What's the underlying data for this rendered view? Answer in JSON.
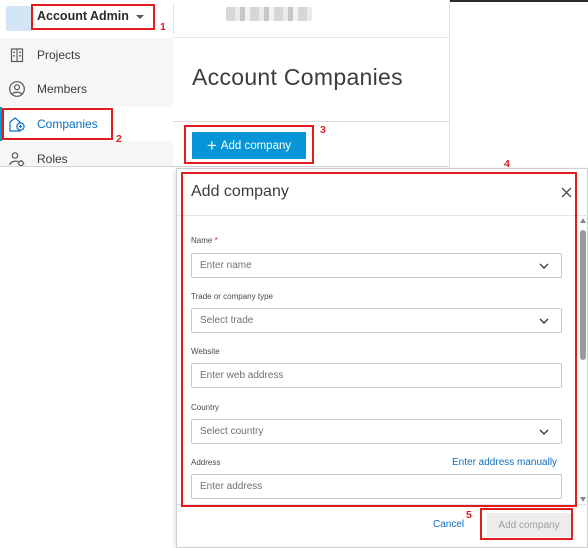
{
  "header": {
    "account_switcher_label": "Account Admin"
  },
  "sidebar": {
    "items": [
      {
        "label": "Projects",
        "icon": "building-icon",
        "active": false
      },
      {
        "label": "Members",
        "icon": "person-circle-icon",
        "active": false
      },
      {
        "label": "Companies",
        "icon": "company-icon",
        "active": true
      },
      {
        "label": "Roles",
        "icon": "person-gear-icon",
        "active": false
      }
    ]
  },
  "main": {
    "title": "Account Companies",
    "add_button_label": "Add company"
  },
  "dialog": {
    "title": "Add company",
    "fields": {
      "name": {
        "label": "Name",
        "required_mark": "*",
        "placeholder": "Enter name"
      },
      "trade": {
        "label": "Trade or company type",
        "placeholder": "Select trade"
      },
      "website": {
        "label": "Website",
        "placeholder": "Enter web address"
      },
      "country": {
        "label": "Country",
        "placeholder": "Select country"
      },
      "address": {
        "label": "Address",
        "placeholder": "Enter address",
        "link": "Enter address manually"
      }
    },
    "cancel_label": "Cancel",
    "submit_label": "Add company"
  },
  "annotations": [
    "1",
    "2",
    "3",
    "4",
    "5"
  ],
  "colors": {
    "accent": "#0696d7",
    "link": "#0a6fc2",
    "annotation": "#e01c1c",
    "sidebar_bg": "#f6f6f6"
  }
}
